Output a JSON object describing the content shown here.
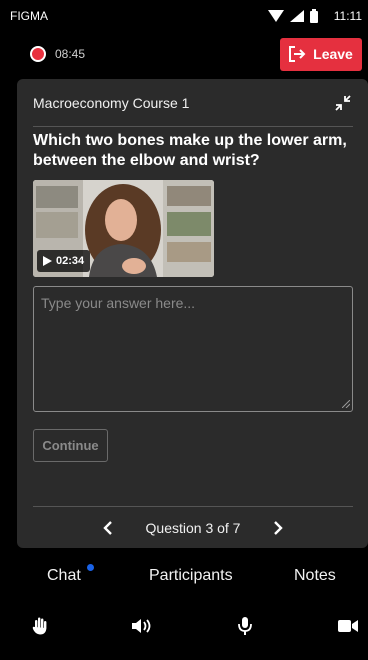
{
  "status_bar": {
    "carrier": "FIGMA",
    "time": "11:11",
    "icons": [
      "wifi-icon",
      "signal-icon",
      "battery-icon"
    ]
  },
  "recording": {
    "time": "08:45",
    "indicator_color": "#e8303e"
  },
  "leave_button": {
    "label": "Leave",
    "icon": "exit-icon",
    "color": "#e5303f"
  },
  "card": {
    "course_title": "Macroeconomy Course 1",
    "collapse_icon": "collapse-icon",
    "question": "Which two bones make up the lower arm, between the elbow and wrist?",
    "video": {
      "duration": "02:34",
      "play_icon": "play-icon"
    },
    "answer": {
      "placeholder": "Type your answer here...",
      "value": ""
    },
    "continue_label": "Continue",
    "pager": {
      "label": "Question 3 of 7",
      "prev_icon": "chevron-left-icon",
      "next_icon": "chevron-right-icon"
    }
  },
  "tabs": [
    {
      "label": "Chat",
      "has_notification": true
    },
    {
      "label": "Participants",
      "has_notification": false
    },
    {
      "label": "Notes",
      "has_notification": false
    }
  ],
  "notification_color": "#1a63e8",
  "controls": [
    "raise-hand-icon",
    "speaker-icon",
    "microphone-icon",
    "camera-icon"
  ]
}
